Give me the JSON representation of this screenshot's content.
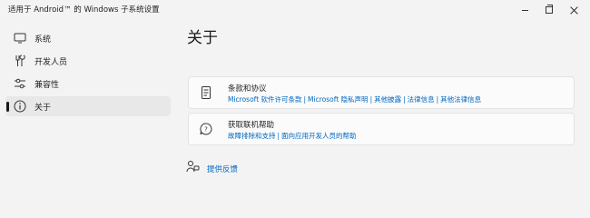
{
  "window": {
    "title": "适用于 Android™ 的 Windows 子系统设置"
  },
  "sidebar": {
    "items": [
      {
        "label": "系统"
      },
      {
        "label": "开发人员"
      },
      {
        "label": "兼容性"
      },
      {
        "label": "关于"
      }
    ]
  },
  "main": {
    "title": "关于",
    "terms_card": {
      "title": "条款和协议",
      "links": [
        "Microsoft 软件许可条款",
        "Microsoft 隐私声明",
        "其他披露",
        "法律信息",
        "其他法律信息"
      ]
    },
    "help_card": {
      "title": "获取联机帮助",
      "links": [
        "故障排除和支持",
        "面向应用开发人员的帮助"
      ]
    },
    "feedback": {
      "label": "提供反馈"
    }
  },
  "colors": {
    "accent": "#0067c0",
    "background": "#f3f3f3",
    "card": "#fbfbfb"
  }
}
